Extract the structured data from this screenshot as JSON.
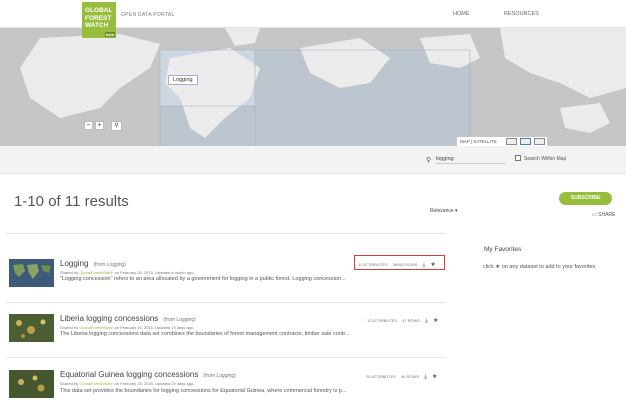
{
  "header": {
    "logo_text_1": "GLOBAL",
    "logo_text_2": "FOREST",
    "logo_text_3": "WATCH",
    "logo_tag": "beta",
    "portal_label": "OPEN DATA PORTAL",
    "nav": [
      "HOME",
      "RESOURCES"
    ]
  },
  "map": {
    "label": "Logging",
    "zoom_out": "−",
    "zoom_in": "+",
    "search_icon": "magnifier-icon",
    "maptype_label": "MAP | SATELLITE"
  },
  "search": {
    "value": "logging",
    "within_map_label": "Search Within Map"
  },
  "results": {
    "title": "1-10 of 11 results",
    "sort_label": "Relevance ▾",
    "subscribe_label": "SUBSCRIBE",
    "share_label": "SHARE",
    "items": [
      {
        "title": "Logging",
        "from": "(from Logging)",
        "meta_prefix": "Shared by ",
        "meta_author": "GlobalForestWatch",
        "meta_suffix": " on February 25, 2015. Updated a month ago.",
        "description": "\"Logging concession\" refers to an area allocated by a government for logging in a public forest. Logging concession...",
        "attributes": "11 ATTRIBUTES",
        "rows": "38963 ROWS"
      },
      {
        "title": "Liberia logging concessions",
        "from": "(from Logging)",
        "meta_prefix": "Shared by ",
        "meta_author": "GlobalForestWatch",
        "meta_suffix": " on February 25, 2015. Updated 19 days ago.",
        "description": "The Liberia logging concessions data set combines the boundaries of forest management contracts, timber sale contr...",
        "attributes": "12 ATTRIBUTES",
        "rows": "47 ROWS"
      },
      {
        "title": "Equatorial Guinea logging concessions",
        "from": "(from Logging)",
        "meta_prefix": "Shared by ",
        "meta_author": "GlobalForestWatch",
        "meta_suffix": " on February 25, 2015. Updated 25 days ago.",
        "description": "This data set provides the boundaries for logging concessions for Equatorial Guinea, where commercial forestry is p...",
        "attributes": "25 ATTRIBUTES",
        "rows": "46 ROWS"
      }
    ]
  },
  "favorites": {
    "title": "My Favorites",
    "text_before": "click ",
    "text_after": " on any dataset to add to your favorites"
  },
  "colors": {
    "brand_green": "#97bd3d",
    "highlight_red": "#d93a3a",
    "map_grey": "#c6c6c6"
  }
}
